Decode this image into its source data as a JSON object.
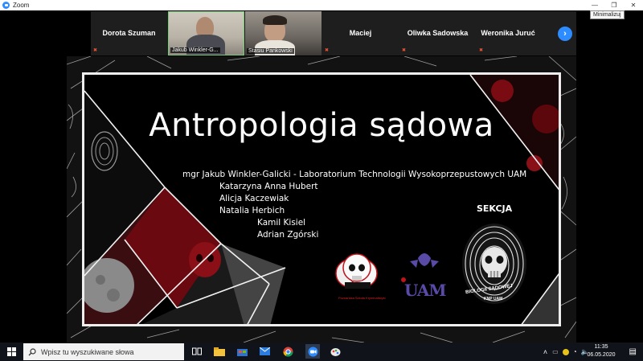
{
  "window": {
    "title": "Zoom",
    "tooltip": "Minimalizuj",
    "buttons": {
      "minimize": "—",
      "restore": "❐",
      "close": "✕"
    }
  },
  "participants": [
    {
      "name": "Dorota Szuman",
      "video": false
    },
    {
      "name": "Jakub Winkler-G...",
      "video": true
    },
    {
      "name": "Stasiu Pankowski",
      "video": true
    },
    {
      "name": "Maciej",
      "video": false
    },
    {
      "name": "Oliwka Sadowska",
      "video": false
    },
    {
      "name": "Weronika Juruć",
      "video": false
    }
  ],
  "slide": {
    "title": "Antropologia sądowa",
    "authors": [
      "mgr Jakub Winkler-Galicki - Laboratorium Technologii Wysokoprzepustowych UAM",
      "Katarzyna Anna Hubert",
      "Alicja Kaczewiak",
      "Natalia Herbich",
      "Kamil Kisiel",
      "Adrian Zgórski"
    ],
    "logo_left_caption": "Poznańska Szkoła Kryminalistyki",
    "logo_uam": "UAM",
    "sekcja_top": "SEKCJA",
    "sekcja_bottom": "BIOLOGII SĄDOWEJ",
    "sekcja_sub": "KNP UAM"
  },
  "taskbar": {
    "search_placeholder": "Wpisz tu wyszukiwane słowa",
    "time": "11:35",
    "date": "06.05.2020"
  },
  "colors": {
    "zoom_blue": "#2d8cff",
    "taskbar": "#10131a",
    "red_accent": "#c0131c"
  }
}
